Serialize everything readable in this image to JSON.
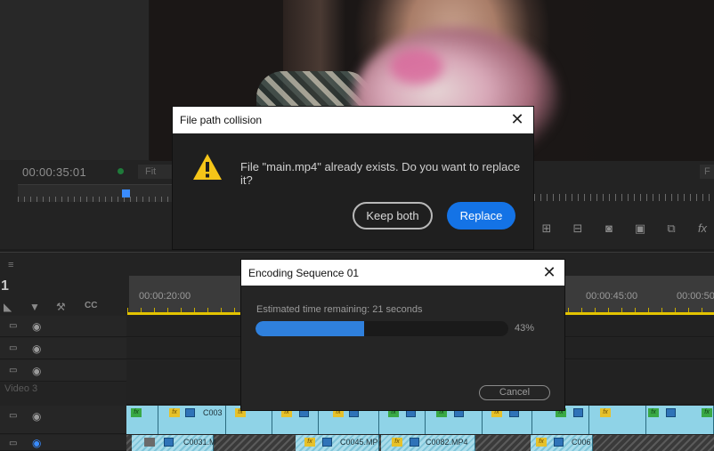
{
  "monitor": {
    "timecode": "00:00:35:01",
    "fit_label": "Fit",
    "fit_label_right": "F"
  },
  "timeline": {
    "sequence_number": "1",
    "menu_icon": "≡",
    "ruler": [
      "00:00:20:00",
      "00:00:45:00",
      "00:00:50"
    ],
    "track_label_video3": "Video 3",
    "clips": [
      "C003",
      "C0031.M",
      "C0045.MP",
      "C0082.MP4",
      "C006"
    ],
    "tools": {
      "cc_label": "CC"
    }
  },
  "collision_dialog": {
    "title": "File path collision",
    "message": "File \"main.mp4\" already exists. Do you want to replace it?",
    "keep_both_label": "Keep both",
    "replace_label": "Replace",
    "close_glyph": "✕"
  },
  "encoding_dialog": {
    "title": "Encoding Sequence 01",
    "eta_text": "Estimated time remaining: 21 seconds",
    "progress_percent": 43,
    "progress_label": "43%",
    "cancel_label": "Cancel",
    "close_glyph": "✕"
  },
  "colors": {
    "accent": "#1473e6",
    "progress": "#2f80dd",
    "timeline_marker": "#e4c400",
    "clip": "#8fd3e7",
    "warning": "#f5c518"
  }
}
